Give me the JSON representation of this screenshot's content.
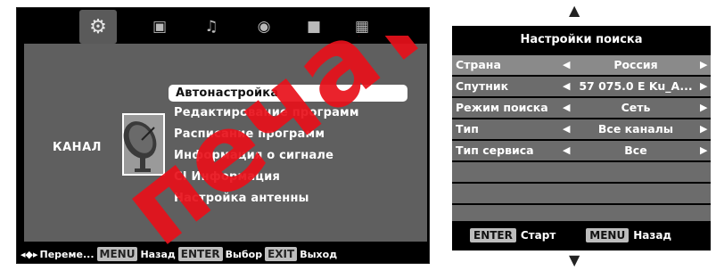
{
  "tv_menu": {
    "tabs": [
      {
        "icon": "gear-icon",
        "glyph": "⚙",
        "active": true
      },
      {
        "icon": "monitor-icon",
        "glyph": "▣",
        "active": false
      },
      {
        "icon": "music-note-icon",
        "glyph": "♫",
        "active": false
      },
      {
        "icon": "clock-icon",
        "glyph": "◉",
        "active": false
      },
      {
        "icon": "lock-icon",
        "glyph": "■",
        "active": false
      },
      {
        "icon": "apps-grid-icon",
        "glyph": "▦",
        "active": false
      }
    ],
    "category_label": "КАНАЛ",
    "items": [
      "Автонастройка",
      "Редактирование программ",
      "Расписание программ",
      "Информация о сигнале",
      "CI Информация",
      "Настройка антенны"
    ],
    "selected_index": 0,
    "bottom_bar": {
      "move_label": "Переме...",
      "menu_key": "MENU",
      "back_label": "Назад",
      "enter_key": "ENTER",
      "select_label": "Выбор",
      "exit_key": "EXIT",
      "exit_label": "Выход"
    }
  },
  "watermark_text": "печать",
  "search_settings": {
    "title": "Настройки поиска",
    "rows": [
      {
        "label": "Страна",
        "value": "Россия",
        "selected": true
      },
      {
        "label": "Спутник",
        "value": "57 075.0 E Ku_A...",
        "selected": false
      },
      {
        "label": "Режим поиска",
        "value": "Сеть",
        "selected": false
      },
      {
        "label": "Тип",
        "value": "Все каналы",
        "selected": false
      },
      {
        "label": "Тип сервиса",
        "value": "Все",
        "selected": false
      }
    ],
    "footer": {
      "enter_key": "ENTER",
      "start_label": "Старт",
      "menu_key": "MENU",
      "back_label": "Назад"
    }
  },
  "colors": {
    "panel_gray": "#5f5f5f",
    "row_gray": "#6c6c6c",
    "watermark_red": "#e8101a"
  }
}
